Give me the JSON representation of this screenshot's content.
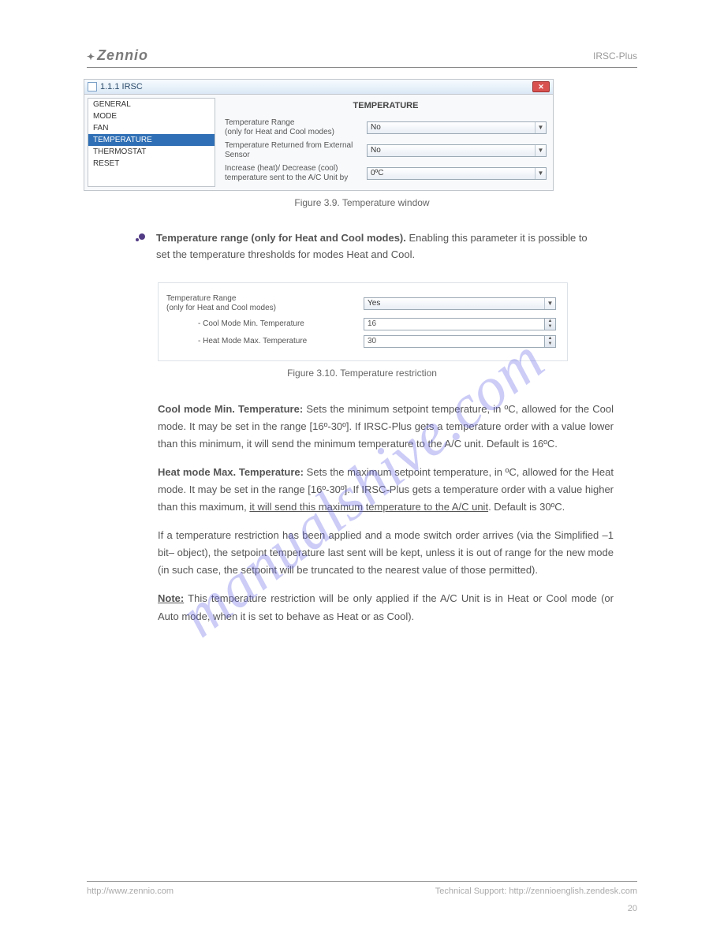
{
  "header": {
    "logo": "Zennio",
    "right": "IRSC-Plus"
  },
  "window1": {
    "title": "1.1.1 IRSC",
    "close_glyph": "✕",
    "sidebar": [
      {
        "label": "GENERAL",
        "sel": false
      },
      {
        "label": "MODE",
        "sel": false
      },
      {
        "label": "FAN",
        "sel": false
      },
      {
        "label": "TEMPERATURE",
        "sel": true
      },
      {
        "label": "THERMOSTAT",
        "sel": false
      },
      {
        "label": "RESET",
        "sel": false
      }
    ],
    "pane_title": "TEMPERATURE",
    "fields": [
      {
        "label": "Temperature Range\n(only for Heat and Cool modes)",
        "value": "No"
      },
      {
        "label": "Temperature Returned from External Sensor",
        "value": "No"
      },
      {
        "label": "Increase (heat)/ Decrease (cool) temperature sent to the A/C Unit by",
        "value": "0ºC"
      }
    ]
  },
  "caption1": "Figure 3.9. Temperature window",
  "bullet": {
    "title": "Temperature range (only for Heat and Cool modes).",
    "text": " Enabling this parameter it is possible to set the temperature thresholds for modes Heat and Cool."
  },
  "window2": {
    "row1_label": "Temperature Range\n(only for Heat and Cool modes)",
    "row1_value": "Yes",
    "row2_label": "- Cool Mode Min. Temperature",
    "row2_value": "16",
    "row3_label": "- Heat Mode Max. Temperature",
    "row3_value": "30"
  },
  "caption2": "Figure 3.10. Temperature restriction",
  "body": {
    "p1a": "Cool mode Min. Temperature:",
    "p1b": " Sets the minimum setpoint temperature, in ºC, allowed for the Cool mode. It may be set in the range [16º-30º]. If IRSC-Plus gets a temperature order with a value lower than this minimum, it will send the minimum temperature to the A/C unit. Default is 16ºC.",
    "p2a": "Heat mode Max. Temperature:",
    "p2b": " Sets the maximum setpoint temperature, in ºC, allowed for the Heat mode. It may be set in the range [16º-30º]. If IRSC-Plus gets a temperature order with a value higher than this maximum, ",
    "p2c": "it will send this maximum temperature to the A/C unit",
    "p2d": ". Default is 30ºC.",
    "p3a": "If a temperature restriction has been applied and a mode switch order arrives (via the Simplified –1 bit– object), the setpoint temperature last sent will be kept, unless it is out of range for the new mode (in such case, the setpoint will be truncated to the nearest value of those permitted).",
    "p4a": "Note:",
    "p4b": " This temperature restriction will be only applied if the A/C Unit is in Heat or Cool mode (or Auto mode, when it is set to behave as Heat or as Cool)."
  },
  "footer": {
    "left": "http://www.zennio.com",
    "right": "Technical Support: http://zennioenglish.zendesk.com",
    "page": "20"
  },
  "watermark": "manualshive.com"
}
